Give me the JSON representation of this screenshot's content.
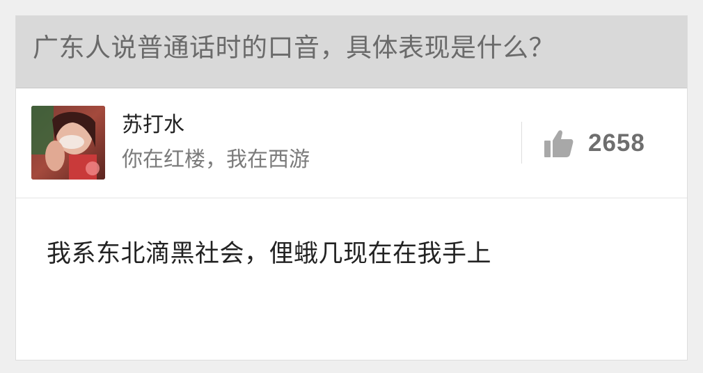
{
  "question": {
    "title": "广东人说普通话时的口音，具体表现是什么？"
  },
  "author": {
    "name": "苏打水",
    "bio": "你在红楼，我在西游"
  },
  "vote": {
    "count": "2658",
    "icon": "thumbs-up-icon"
  },
  "answer": {
    "text": "我系东北滴黑社会，俚蛾几现在在我手上"
  },
  "colors": {
    "page_background": "#efefef",
    "question_bar": "#d9d9d9",
    "card": "#ffffff",
    "muted_text": "#7b7b7b",
    "primary_text": "#222222"
  }
}
